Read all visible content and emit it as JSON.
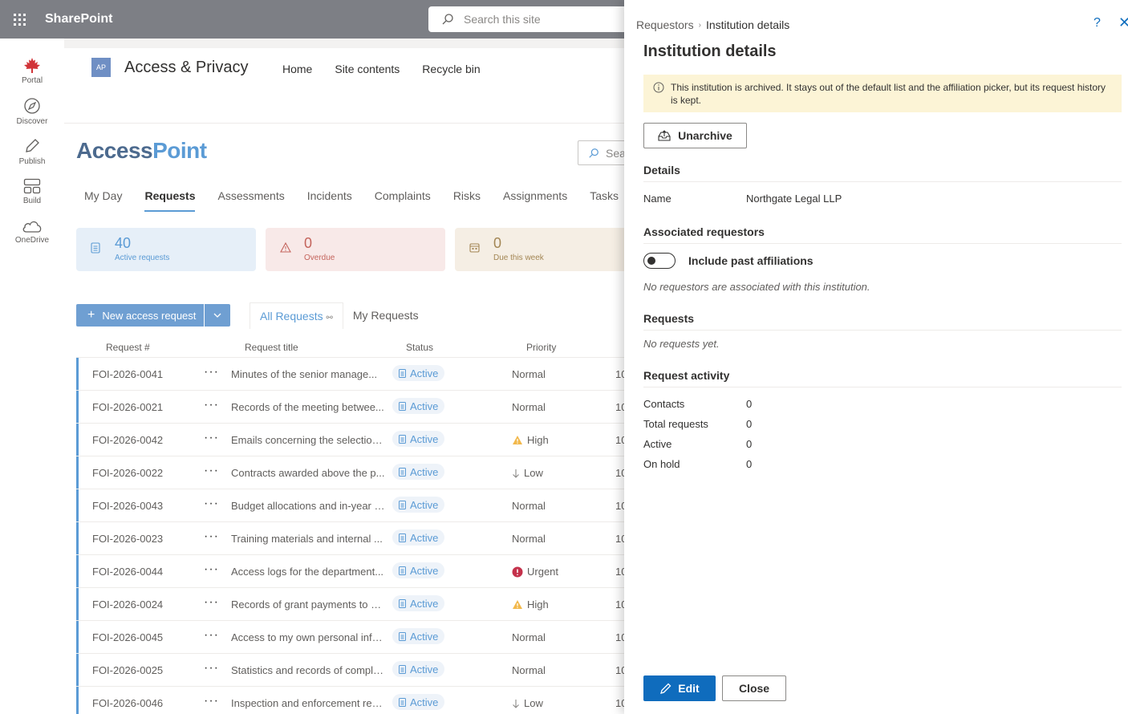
{
  "suite": {
    "brand": "SharePoint",
    "search_placeholder": "Search this site"
  },
  "rail": [
    {
      "label": "Portal",
      "icon": "maple-leaf-icon"
    },
    {
      "label": "Discover",
      "icon": "compass-icon"
    },
    {
      "label": "Publish",
      "icon": "pen-icon"
    },
    {
      "label": "Build",
      "icon": "blocks-icon"
    },
    {
      "label": "OneDrive",
      "icon": "cloud-icon"
    }
  ],
  "site": {
    "logo": "AP",
    "title": "Access & Privacy",
    "nav": [
      "Home",
      "Site contents",
      "Recycle bin"
    ]
  },
  "app": {
    "logo_a": "Access",
    "logo_b": "Point",
    "search_placeholder": "Sea",
    "tabs": [
      "My Day",
      "Requests",
      "Assessments",
      "Incidents",
      "Complaints",
      "Risks",
      "Assignments",
      "Tasks"
    ],
    "active_tab": "Requests"
  },
  "kpis": [
    {
      "value": "40",
      "label": "Active requests"
    },
    {
      "value": "0",
      "label": "Overdue"
    },
    {
      "value": "0",
      "label": "Due this week"
    }
  ],
  "toolbar": {
    "new_label": "New access request",
    "view_all": "All Requests",
    "view_mine": "My Requests"
  },
  "grid": {
    "headers": {
      "num": "Request #",
      "title": "Request title",
      "status": "Status",
      "priority": "Priority"
    },
    "rows": [
      {
        "num": "FOI-2026-0041",
        "title": "Minutes of the senior manage...",
        "status": "Active",
        "priority": "Normal",
        "cut": "10"
      },
      {
        "num": "FOI-2026-0021",
        "title": "Records of the meeting betwee...",
        "status": "Active",
        "priority": "Normal",
        "cut": "10"
      },
      {
        "num": "FOI-2026-0042",
        "title": "Emails concerning the selection...",
        "status": "Active",
        "priority": "High",
        "cut": "10"
      },
      {
        "num": "FOI-2026-0022",
        "title": "Contracts awarded above the p...",
        "status": "Active",
        "priority": "Low",
        "cut": "10"
      },
      {
        "num": "FOI-2026-0043",
        "title": "Budget allocations and in-year r...",
        "status": "Active",
        "priority": "Normal",
        "cut": "10"
      },
      {
        "num": "FOI-2026-0023",
        "title": "Training materials and internal ...",
        "status": "Active",
        "priority": "Normal",
        "cut": "10"
      },
      {
        "num": "FOI-2026-0044",
        "title": "Access logs for the department...",
        "status": "Active",
        "priority": "Urgent",
        "cut": "10"
      },
      {
        "num": "FOI-2026-0024",
        "title": "Records of grant payments to a...",
        "status": "Active",
        "priority": "High",
        "cut": "10"
      },
      {
        "num": "FOI-2026-0045",
        "title": "Access to my own personal info...",
        "status": "Active",
        "priority": "Normal",
        "cut": "10"
      },
      {
        "num": "FOI-2026-0025",
        "title": "Statistics and records of compla...",
        "status": "Active",
        "priority": "Normal",
        "cut": "10"
      },
      {
        "num": "FOI-2026-0046",
        "title": "Inspection and enforcement rec...",
        "status": "Active",
        "priority": "Low",
        "cut": "10"
      }
    ]
  },
  "panel": {
    "crumb_parent": "Requestors",
    "crumb_current": "Institution details",
    "title": "Institution details",
    "banner": "This institution is archived. It stays out of the default list and the affiliation picker, but its request history is kept.",
    "unarchive_label": "Unarchive",
    "details_heading": "Details",
    "name_label": "Name",
    "name_value": "Northgate Legal LLP",
    "assoc_heading": "Associated requestors",
    "toggle_label": "Include past affiliations",
    "toggle_on": false,
    "assoc_empty": "No requestors are associated with this institution.",
    "requests_heading": "Requests",
    "requests_empty": "No requests yet.",
    "activity_heading": "Request activity",
    "activity": [
      {
        "label": "Contacts",
        "value": "0"
      },
      {
        "label": "Total requests",
        "value": "0"
      },
      {
        "label": "Active",
        "value": "0"
      },
      {
        "label": "On hold",
        "value": "0"
      }
    ],
    "edit_label": "Edit",
    "close_label": "Close"
  },
  "colors": {
    "accent": "#5b9bd5",
    "primary": "#0f6cbd",
    "banner": "#fcf4d6",
    "suitebar": "#7d7f85"
  }
}
